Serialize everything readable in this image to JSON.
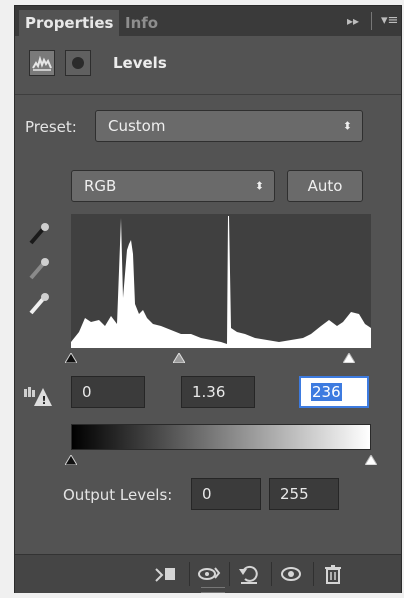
{
  "tabs": {
    "active": "Properties",
    "inactive": "Info"
  },
  "header": {
    "title": "Levels"
  },
  "preset": {
    "label": "Preset:",
    "value": "Custom"
  },
  "channel": {
    "value": "RGB"
  },
  "auto_button": "Auto",
  "input_levels": {
    "black": "0",
    "gamma": "1.36",
    "white": "236"
  },
  "output": {
    "label": "Output Levels:",
    "black": "0",
    "white": "255"
  },
  "icons": {
    "eyedropper_black": "eyedropper-icon",
    "eyedropper_gray": "eyedropper-icon",
    "eyedropper_white": "eyedropper-icon",
    "histogram": "histogram-icon",
    "warning": "warning-icon",
    "clip": "clip-to-layer-icon",
    "view_previous": "view-previous-icon",
    "reset": "reset-icon",
    "visibility": "eye-icon",
    "delete": "trash-icon"
  }
}
